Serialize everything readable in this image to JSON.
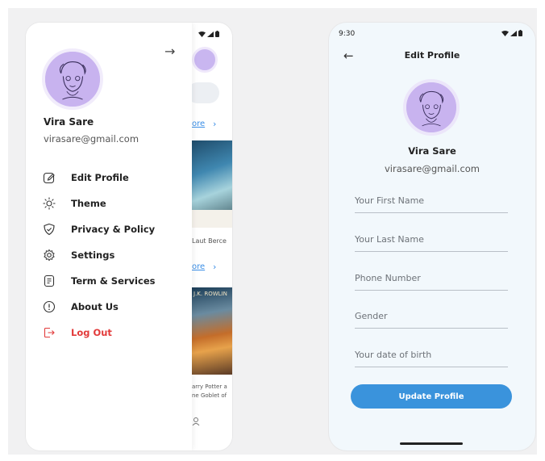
{
  "colors": {
    "accent": "#3a93dc",
    "logout": "#e23b3b",
    "avatar_bg": "#c8b3ef"
  },
  "drawer": {
    "user_name": "Vira Sare",
    "user_email": "virasare@gmail.com",
    "close_icon": "arrow-right-icon",
    "items": [
      {
        "label": "Edit Profile",
        "icon": "edit-icon"
      },
      {
        "label": "Theme",
        "icon": "sun-icon"
      },
      {
        "label": "Privacy & Policy",
        "icon": "shield-check-icon"
      },
      {
        "label": "Settings",
        "icon": "gear-icon"
      },
      {
        "label": "Term & Services",
        "icon": "document-icon"
      },
      {
        "label": "About Us",
        "icon": "info-icon"
      },
      {
        "label": "Log Out",
        "icon": "logout-icon"
      }
    ]
  },
  "background_app": {
    "more_link_1": "ore",
    "more_link_2": "ore",
    "book1_title": "Laut Berce",
    "book2_author": "J.K. ROWLIN",
    "book2_title_line1": "arry Potter a",
    "book2_title_line2": "ne Goblet of"
  },
  "edit_profile": {
    "status_time": "9:30",
    "title": "Edit Profile",
    "name": "Vira Sare",
    "email": "virasare@gmail.com",
    "fields": [
      {
        "placeholder": "Your First Name",
        "value": ""
      },
      {
        "placeholder": "Your Last Name",
        "value": ""
      },
      {
        "placeholder": "Phone Number",
        "value": ""
      },
      {
        "placeholder": "Gender",
        "value": ""
      },
      {
        "placeholder": "Your date of birth",
        "value": ""
      }
    ],
    "button_label": "Update Profile"
  }
}
